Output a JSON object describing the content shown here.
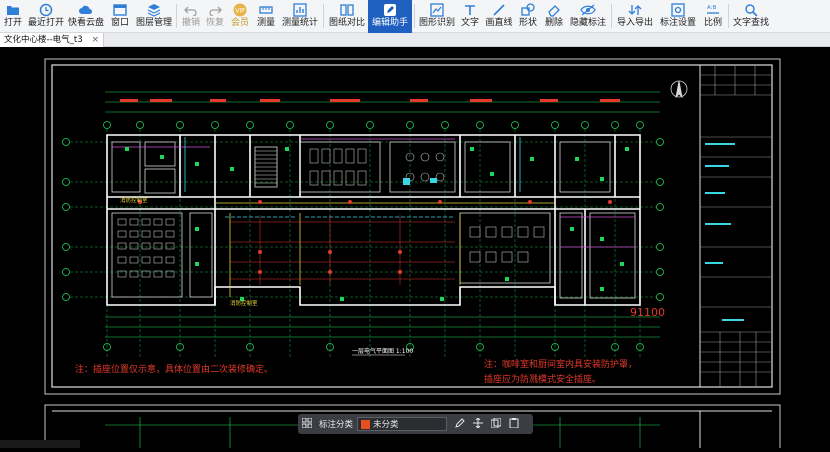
{
  "toolbar": {
    "items": [
      {
        "label": "打开",
        "icon": "folder-icon"
      },
      {
        "label": "最近打开",
        "icon": "clock-icon"
      },
      {
        "label": "快看云盘",
        "icon": "cloud-icon"
      },
      {
        "label": "窗口",
        "icon": "window-icon"
      },
      {
        "label": "图层管理",
        "icon": "layers-icon"
      },
      {
        "label": "撤销",
        "icon": "undo-icon"
      },
      {
        "label": "恢复",
        "icon": "redo-icon"
      },
      {
        "label": "会员",
        "icon": "vip-icon"
      },
      {
        "label": "测量",
        "icon": "measure-icon"
      },
      {
        "label": "测量统计",
        "icon": "measure-stats-icon"
      },
      {
        "label": "图纸对比",
        "icon": "compare-icon"
      },
      {
        "label": "编辑助手",
        "icon": "edit-assistant-icon"
      },
      {
        "label": "图形识别",
        "icon": "shape-recognize-icon"
      },
      {
        "label": "文字",
        "icon": "text-icon"
      },
      {
        "label": "画直线",
        "icon": "line-icon"
      },
      {
        "label": "形状",
        "icon": "shape-icon"
      },
      {
        "label": "删除",
        "icon": "eraser-icon"
      },
      {
        "label": "隐藏标注",
        "icon": "hide-annotation-icon"
      },
      {
        "label": "导入导出",
        "icon": "import-export-icon"
      },
      {
        "label": "标注设置",
        "icon": "annotation-settings-icon"
      },
      {
        "label": "比例",
        "icon": "scale-icon"
      },
      {
        "label": "文字查找",
        "icon": "text-search-icon"
      }
    ],
    "vip_badge": "VIP"
  },
  "tab": {
    "title": "文化中心楼--电气_t3",
    "close": "×"
  },
  "drawing": {
    "title": "一层电气平面图 1:100",
    "note_left": "注：插座位置仅示意，具体位置由二次装修确定。",
    "note_right_1": "注：咖啡室和厨间室内具安装防护罩，",
    "note_right_2": "插座应为防溅模式安全插座。",
    "elevation": "91100",
    "grid_labels_top": [
      "1",
      "2",
      "3",
      "4",
      "5",
      "6",
      "7",
      "8",
      "9",
      "10",
      "11",
      "12",
      "13",
      "14",
      "15",
      "16",
      "17",
      "18"
    ],
    "grid_labels_side": [
      "F",
      "E",
      "D",
      "C",
      "B",
      "A"
    ],
    "room_label_a": "消防控制室",
    "room_label_b": "消防控制室"
  },
  "floatbar": {
    "category_label": "标注分类",
    "category_value": "未分类",
    "swatch_color": "#e5501e"
  },
  "colors": {
    "accent": "#1f5fbf",
    "cad_wall": "#ffffff",
    "cad_green": "#1fd65a",
    "cad_red": "#e33a2a",
    "cad_yellow": "#e6d43a",
    "cad_magenta": "#d24fd6",
    "cad_cyan": "#3ad6e6"
  }
}
